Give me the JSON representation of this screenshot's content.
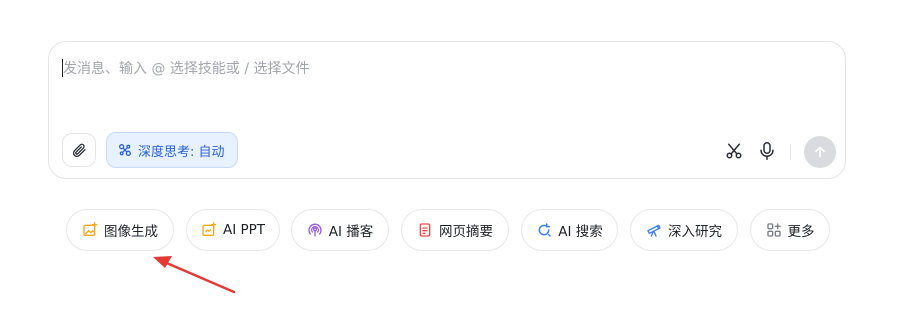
{
  "header": {
    "partial_title": ""
  },
  "composer": {
    "placeholder": "发消息、输入 @ 选择技能或 / 选择文件",
    "deep_think_label": "深度思考: 自动"
  },
  "chips": [
    {
      "label": "图像生成",
      "icon": "image-gen-icon",
      "color": "#f0a81f"
    },
    {
      "label": "AI PPT",
      "icon": "ppt-icon",
      "color": "#f0a81f"
    },
    {
      "label": "AI 播客",
      "icon": "podcast-icon",
      "color": "#9a5ce6"
    },
    {
      "label": "网页摘要",
      "icon": "web-summary-icon",
      "color": "#ef4a4a"
    },
    {
      "label": "AI 搜索",
      "icon": "search-icon",
      "color": "#3b7bf6"
    },
    {
      "label": "深入研究",
      "icon": "telescope-icon",
      "color": "#3b7bf6"
    },
    {
      "label": "更多",
      "icon": "more-grid-icon",
      "color": "#777d86"
    }
  ],
  "colors": {
    "accent": "#2a63d6",
    "deep_think_bg": "#e8f1ff",
    "annotation_arrow": "#e53935",
    "send_disabled": "#d9dbde"
  }
}
